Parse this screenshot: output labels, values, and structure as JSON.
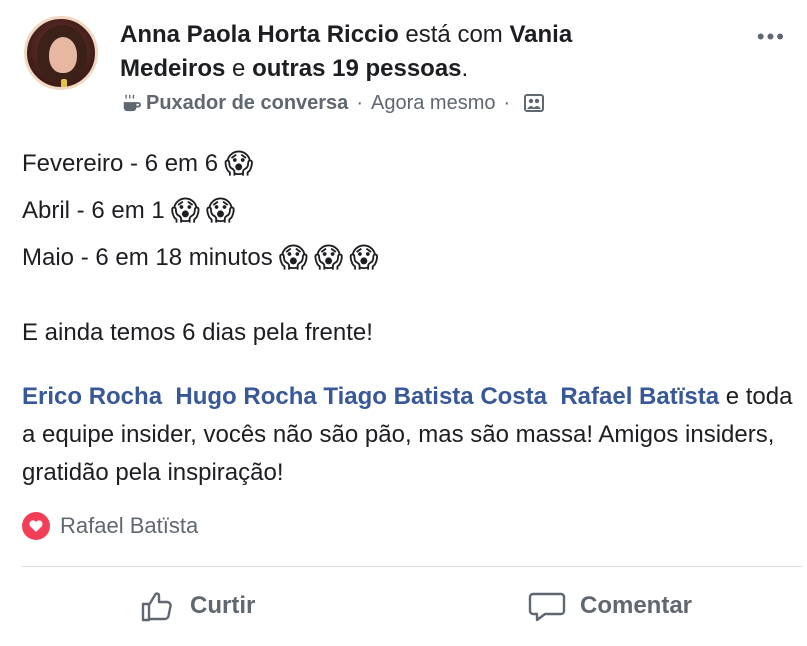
{
  "post": {
    "author": "Anna Paola Horta Riccio",
    "with_text": "está com",
    "tagged_person": "Vania Medeiros",
    "and_text": "e",
    "others": "outras 19 pessoas",
    "period": ".",
    "activity": "Puxador de conversa",
    "time": "Agora mesmo",
    "dot": "·",
    "lines": [
      {
        "text": "Fevereiro - 6 em 6",
        "emoji_count": 1
      },
      {
        "text": "Abril - 6 em 1",
        "emoji_count": 2
      },
      {
        "text": "Maio - 6 em 18 minutos",
        "emoji_count": 3
      }
    ],
    "emoji": "😱",
    "remaining": "E ainda temos 6 dias pela frente!",
    "mentions": [
      "Erico Rocha",
      "Hugo Rocha",
      "Tiago Batista Costa",
      "Rafael Batïsta"
    ],
    "thanks_text": "e toda a equipe insider, vocês não são pão, mas são massa! Amigos insiders, gratidão pela inspiração!",
    "more_icon": "more-dots-icon",
    "activity_icon": "coffee-icon",
    "audience_icon": "group-icon"
  },
  "reactions": {
    "name": "Rafael Batïsta",
    "icon": "heart-icon",
    "color": "#f33e58"
  },
  "actions": {
    "like_label": "Curtir",
    "comment_label": "Comentar"
  },
  "colors": {
    "mention": "#385898",
    "meta": "#606770"
  }
}
